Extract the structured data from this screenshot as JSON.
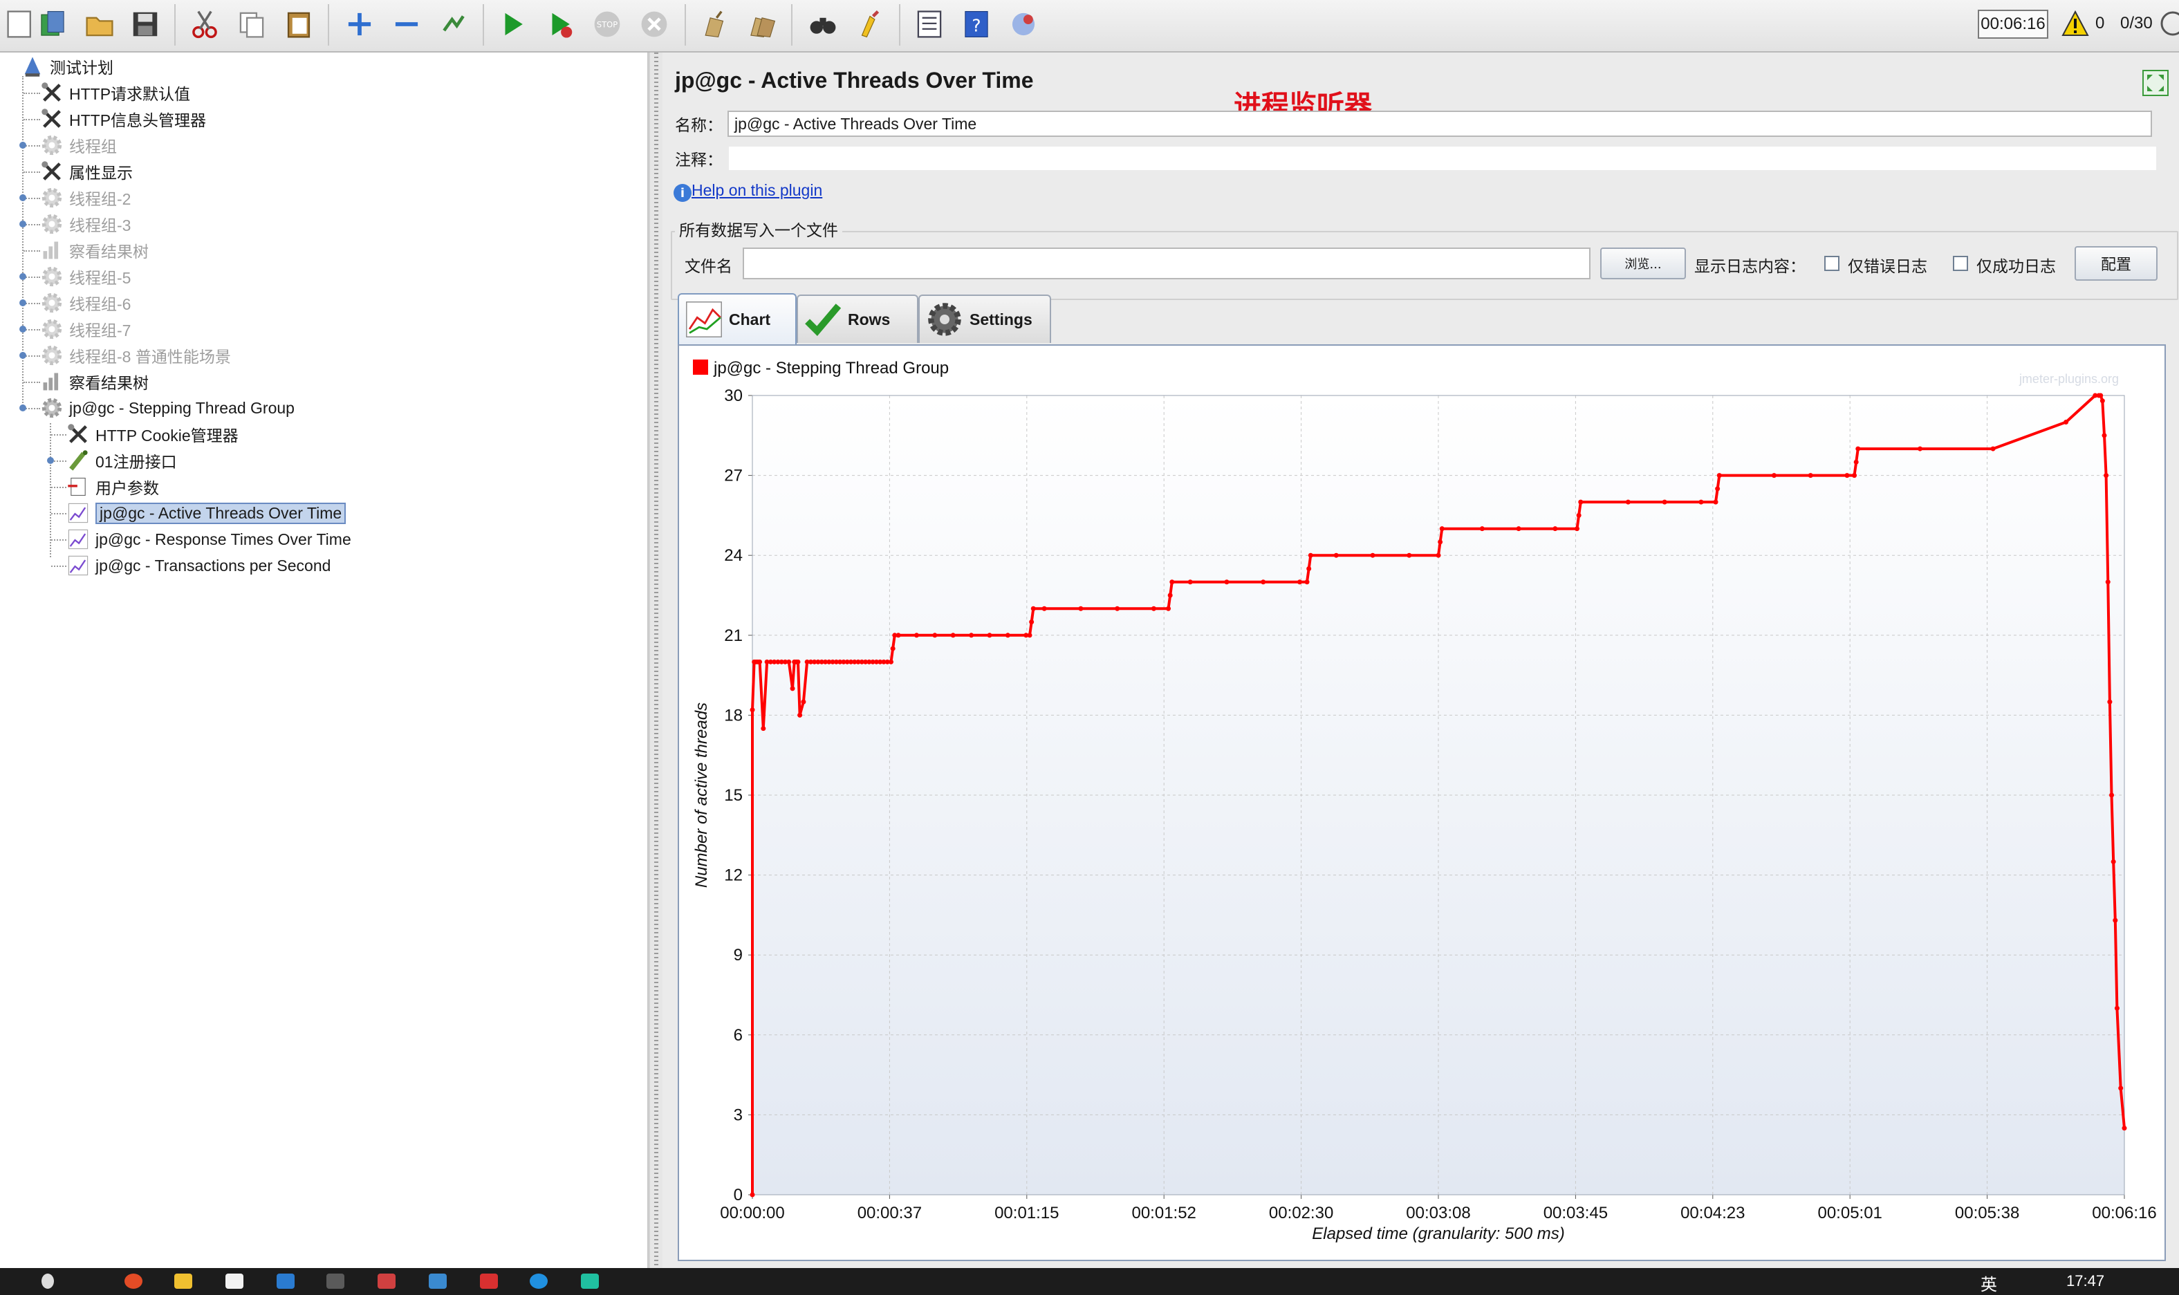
{
  "toolbar": {
    "buttons": [
      "new",
      "templates",
      "open",
      "save",
      "cut",
      "copy",
      "paste",
      "expand",
      "collapse",
      "toggle",
      "start",
      "start-no-pauses",
      "stop",
      "shutdown",
      "clear",
      "clear-all",
      "search",
      "reset-search",
      "function-helper",
      "help",
      "remote"
    ],
    "elapsed_time": "00:06:16",
    "warning_count": "0",
    "active_threads": "0/30"
  },
  "tree": {
    "items": [
      {
        "label": "测试计划",
        "icon": "test-plan-icon",
        "level": 0,
        "disabled": false
      },
      {
        "label": "HTTP请求默认值",
        "icon": "wrench-icon",
        "level": 1,
        "disabled": false
      },
      {
        "label": "HTTP信息头管理器",
        "icon": "wrench-icon",
        "level": 1,
        "disabled": false
      },
      {
        "label": "线程组",
        "icon": "gear-icon",
        "level": 1,
        "disabled": true
      },
      {
        "label": "属性显示",
        "icon": "wrench-icon",
        "level": 1,
        "disabled": false
      },
      {
        "label": "线程组-2",
        "icon": "gear-icon",
        "level": 1,
        "disabled": true
      },
      {
        "label": "线程组-3",
        "icon": "gear-icon",
        "level": 1,
        "disabled": true
      },
      {
        "label": "察看结果树",
        "icon": "listener-icon",
        "level": 1,
        "disabled": true
      },
      {
        "label": "线程组-5",
        "icon": "gear-icon",
        "level": 1,
        "disabled": true
      },
      {
        "label": "线程组-6",
        "icon": "gear-icon",
        "level": 1,
        "disabled": true
      },
      {
        "label": "线程组-7",
        "icon": "gear-icon",
        "level": 1,
        "disabled": true
      },
      {
        "label": "线程组-8 普通性能场景",
        "icon": "gear-icon",
        "level": 1,
        "disabled": true
      },
      {
        "label": "察看结果树",
        "icon": "listener-icon",
        "level": 1,
        "disabled": false
      },
      {
        "label": "jp@gc - Stepping Thread Group",
        "icon": "gear-icon",
        "level": 1,
        "disabled": false
      },
      {
        "label": "HTTP Cookie管理器",
        "icon": "wrench-icon",
        "level": 2,
        "disabled": false
      },
      {
        "label": "01注册接口",
        "icon": "sampler-icon",
        "level": 2,
        "disabled": false
      },
      {
        "label": "用户参数",
        "icon": "preprocessor-icon",
        "level": 2,
        "disabled": false
      },
      {
        "label": "jp@gc - Active Threads Over Time",
        "icon": "graph-icon",
        "level": 2,
        "disabled": false,
        "selected": true
      },
      {
        "label": "jp@gc - Response Times Over Time",
        "icon": "graph-icon",
        "level": 2,
        "disabled": false
      },
      {
        "label": "jp@gc - Transactions per Second",
        "icon": "graph-icon",
        "level": 2,
        "disabled": false
      }
    ]
  },
  "panel": {
    "title": "jp@gc - Active Threads Over Time",
    "annotation": "进程监听器",
    "name_label": "名称：",
    "name_value": "jp@gc - Active Threads Over Time",
    "comment_label": "注释：",
    "comment_value": "",
    "help_link": "Help on this plugin",
    "file_group_title": "所有数据写入一个文件",
    "file_label": "文件名",
    "file_value": "",
    "browse_label": "浏览...",
    "log_label": "显示日志内容：",
    "errors_only_label": "仅错误日志",
    "success_only_label": "仅成功日志",
    "configure_label": "配置",
    "tabs": [
      "Chart",
      "Rows",
      "Settings"
    ],
    "active_tab": "Chart"
  },
  "chart_data": {
    "type": "line",
    "legend": "jp@gc - Stepping Thread Group",
    "legend_placement": "top-left",
    "watermark": "jmeter-plugins.org",
    "ylabel": "Number of active threads",
    "xlabel": "Elapsed time (granularity: 500 ms)",
    "ylim": [
      0,
      30
    ],
    "y_ticks": [
      "0",
      "3",
      "6",
      "9",
      "12",
      "15",
      "18",
      "21",
      "24",
      "27",
      "30"
    ],
    "x_ticks": [
      "00:00:00",
      "00:00:37",
      "00:01:15",
      "00:01:52",
      "00:02:30",
      "00:03:08",
      "00:03:45",
      "00:04:23",
      "00:05:01",
      "00:05:38",
      "00:06:16"
    ],
    "xlim_seconds": [
      0,
      376
    ],
    "grid": true,
    "series_color": "#ff0000",
    "series": [
      {
        "name": "jp@gc - Stepping Thread Group",
        "x_seconds": [
          0,
          0,
          0.5,
          1,
          1.5,
          2,
          3,
          4,
          5,
          6,
          7,
          8,
          9,
          10,
          11,
          11.5,
          12,
          12.5,
          13,
          14,
          15,
          16,
          17,
          18,
          19,
          20,
          21,
          22,
          23,
          24,
          25,
          26,
          27,
          28,
          29,
          30,
          31,
          32,
          33,
          34,
          35,
          36,
          37,
          38,
          38.5,
          39,
          40,
          45,
          50,
          55,
          60,
          65,
          70,
          75,
          76,
          76.5,
          77,
          80,
          90,
          100,
          110,
          114,
          114.5,
          115,
          120,
          130,
          140,
          150,
          152,
          152.5,
          153,
          160,
          170,
          180,
          188,
          188.5,
          189,
          200,
          210,
          220,
          226,
          226.5,
          227,
          240,
          250,
          260,
          264,
          264.5,
          265,
          280,
          290,
          300,
          302,
          302.5,
          303,
          320,
          340,
          360,
          368,
          369,
          369.5,
          370,
          370.5,
          371,
          371.5,
          372,
          372.5,
          373,
          373.5,
          374,
          375,
          376
        ],
        "y": [
          0,
          18.2,
          20,
          20,
          20,
          20,
          17.5,
          20,
          20,
          20,
          20,
          20,
          20,
          20,
          19,
          20,
          20,
          20,
          18,
          18.5,
          20,
          20,
          20,
          20,
          20,
          20,
          20,
          20,
          20,
          20,
          20,
          20,
          20,
          20,
          20,
          20,
          20,
          20,
          20,
          20,
          20,
          20,
          20,
          20,
          20.5,
          21,
          21,
          21,
          21,
          21,
          21,
          21,
          21,
          21,
          21,
          21.5,
          22,
          22,
          22,
          22,
          22,
          22,
          22.5,
          23,
          23,
          23,
          23,
          23,
          23,
          23.5,
          24,
          24,
          24,
          24,
          24,
          24.5,
          25,
          25,
          25,
          25,
          25,
          25.5,
          26,
          26,
          26,
          26,
          26,
          26.5,
          27,
          27,
          27,
          27,
          27,
          27.5,
          28,
          28,
          28,
          29,
          30,
          30,
          30,
          29.8,
          28.5,
          27,
          23,
          18.5,
          15,
          12.5,
          10.3,
          7,
          4,
          2.5,
          0,
          0
        ]
      }
    ]
  },
  "taskbar": {
    "ime_label": "英",
    "clock": "17:47"
  },
  "colors": {
    "accent": "#ff0000",
    "link": "#1238c8",
    "annotation": "#e0101a",
    "selection": "#c3d4ec"
  }
}
